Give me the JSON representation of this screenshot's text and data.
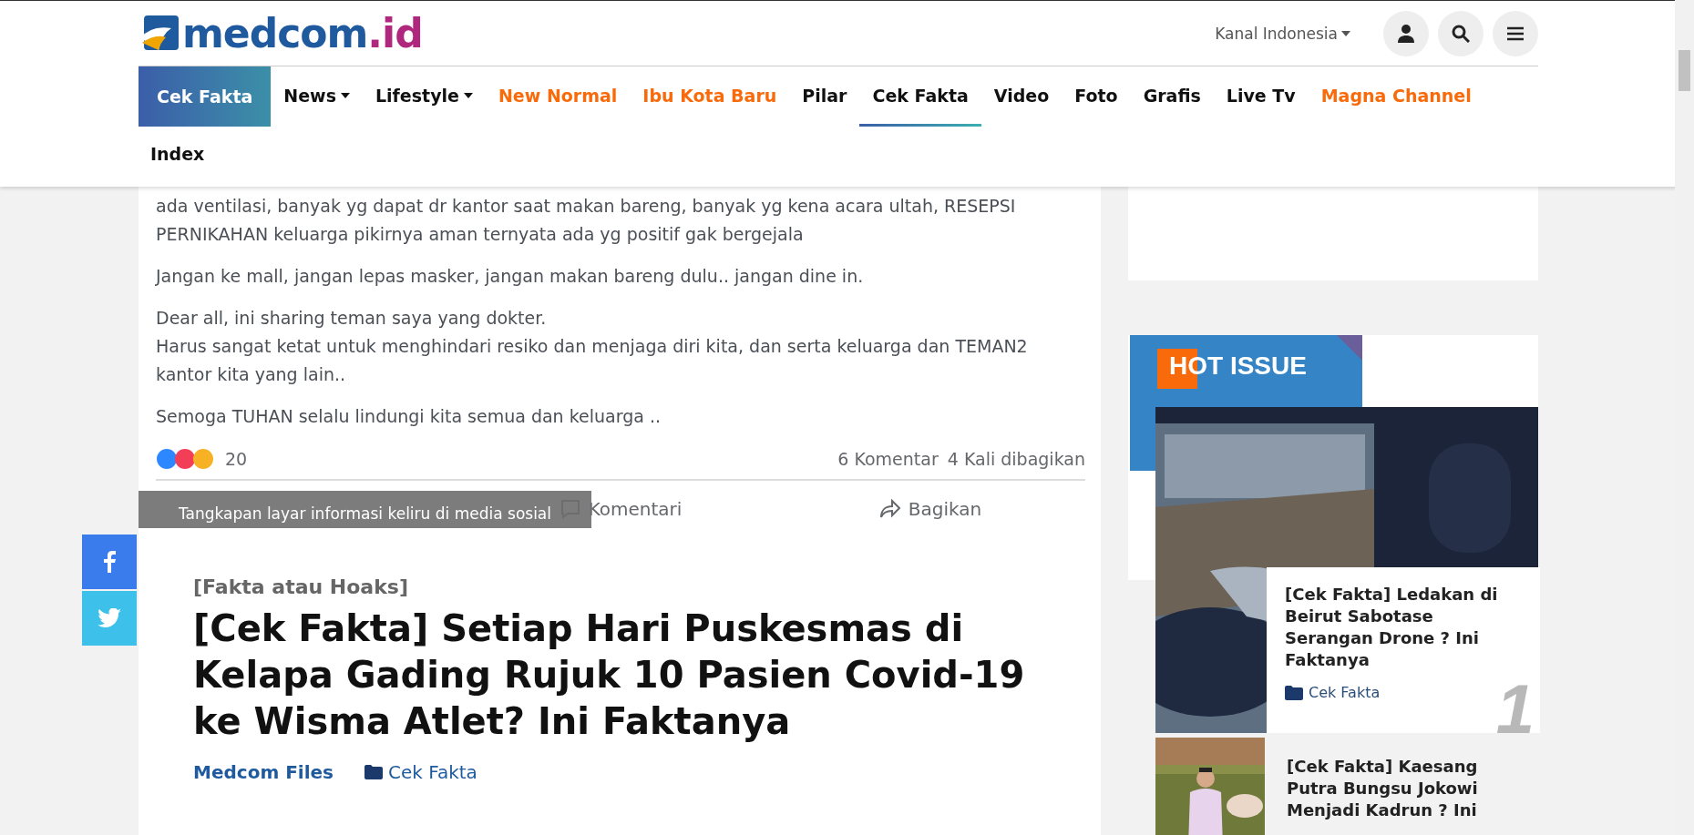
{
  "header": {
    "logo": {
      "text": "medcom",
      "suffix": ".id"
    },
    "channel_menu": "Kanal Indonesia"
  },
  "nav": {
    "featured": "Cek Fakta",
    "items": [
      {
        "label": "News",
        "dropdown": true,
        "selected": false
      },
      {
        "label": "Lifestyle",
        "dropdown": true,
        "selected": false
      },
      {
        "label": "New Normal",
        "dropdown": false,
        "selected": false,
        "color": "#f86a0a"
      },
      {
        "label": "Ibu Kota Baru",
        "dropdown": false,
        "selected": false,
        "color": "#f86a0a"
      },
      {
        "label": "Pilar",
        "dropdown": false,
        "selected": false
      },
      {
        "label": "Cek Fakta",
        "dropdown": false,
        "selected": true
      },
      {
        "label": "Video",
        "dropdown": false,
        "selected": false
      },
      {
        "label": "Foto",
        "dropdown": false,
        "selected": false
      },
      {
        "label": "Grafis",
        "dropdown": false,
        "selected": false
      },
      {
        "label": "Live Tv",
        "dropdown": false,
        "selected": false
      },
      {
        "label": "Magna Channel",
        "dropdown": false,
        "selected": false,
        "color": "#f86a0a"
      }
    ],
    "second_row": [
      "Index"
    ]
  },
  "post_screenshot": {
    "paragraphs": [
      "ada ventilasi, banyak yg dapat dr kantor saat makan bareng, banyak yg kena acara ultah, RESEPSI PERNIKAHAN keluarga pikirnya aman ternyata ada yg positif gak bergejala",
      "Jangan ke mall, jangan lepas masker, jangan makan bareng dulu..  jangan dine in.",
      "Dear all, ini sharing teman saya yang dokter.\nHarus sangat ketat untuk menghindari resiko dan menjaga diri kita, dan serta keluarga dan TEMAN2 kantor kita yang lain..",
      "Semoga TUHAN selalu lindungi kita semua dan keluarga .."
    ],
    "reaction_count": "20",
    "comments": "6 Komentar",
    "shares": "4 Kali dibagikan",
    "actions": [
      {
        "kind": "comment",
        "label": "Komentari"
      },
      {
        "kind": "share",
        "label": "Bagikan"
      }
    ],
    "caption": "Tangkapan layar informasi keliru di media sosial"
  },
  "article": {
    "category": "[Fakta atau Hoaks]",
    "title": "[Cek Fakta] Setiap Hari Puskesmas di Kelapa Gading Rujuk 10 Pasien Covid-19 ke Wisma Atlet? Ini Faktanya",
    "author": "Medcom Files",
    "section": "Cek Fakta"
  },
  "share_buttons": [
    {
      "kind": "facebook"
    },
    {
      "kind": "twitter"
    }
  ],
  "hot_issue": {
    "title": "HOT ISSUE",
    "items": [
      {
        "title": "[Cek Fakta] Ledakan di Beirut Sabotase Serangan Drone ? Ini Faktanya",
        "category": "Cek Fakta",
        "rank": "1",
        "kind": "featured"
      },
      {
        "title": "[Cek Fakta] Kaesang Putra Bungsu Jokowi Menjadi Kadrun ? Ini",
        "kind": "compact"
      }
    ]
  }
}
